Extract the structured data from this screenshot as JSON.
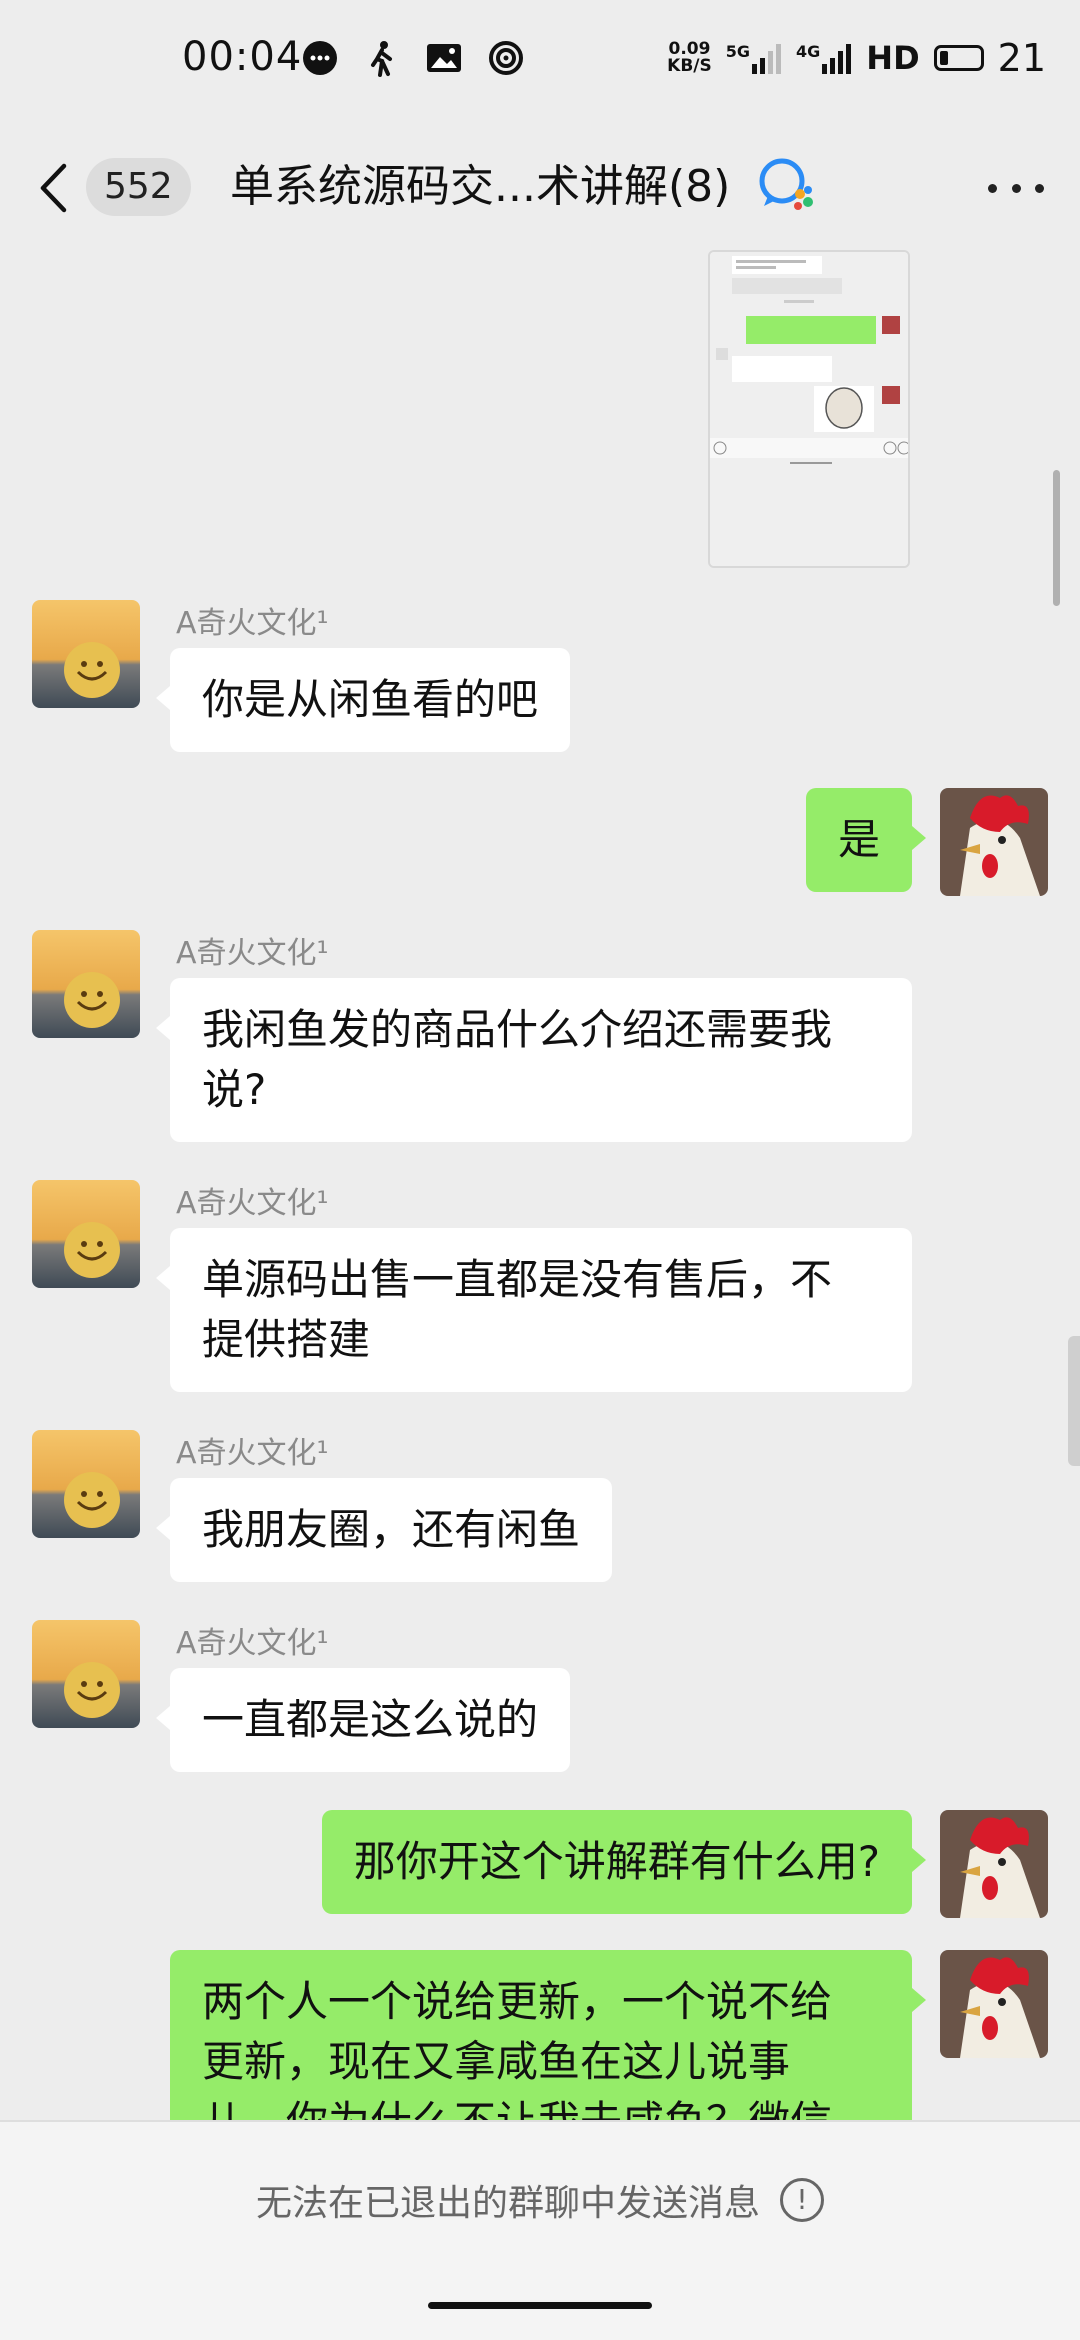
{
  "status_bar": {
    "time": "00:04",
    "net_speed_top": "0.09",
    "net_speed_bottom": "KB/S",
    "signal_1": "5G",
    "signal_2": "4G",
    "hd": "HD",
    "battery": "21"
  },
  "nav": {
    "back_icon": "chevron-left-icon",
    "unread_count": "552",
    "title": "单系统源码交...术讲解(8)",
    "more_icon": "more-dots-icon"
  },
  "messages": [
    {
      "side": "left",
      "sender": "A奇火文化¹",
      "text": "你是从闲鱼看的吧"
    },
    {
      "side": "right",
      "text": "是"
    },
    {
      "side": "left",
      "sender": "A奇火文化¹",
      "line1": "我闲鱼发的商品什么介绍还需要我",
      "line2": "说?"
    },
    {
      "side": "left",
      "sender": "A奇火文化¹",
      "line1": "单源码出售一直都是没有售后，不",
      "line2": "提供搭建"
    },
    {
      "side": "left",
      "sender": "A奇火文化¹",
      "text": "我朋友圈，还有闲鱼"
    },
    {
      "side": "left",
      "sender": "A奇火文化¹",
      "text": "一直都是这么说的"
    },
    {
      "side": "right",
      "text": "那你开这个讲解群有什么用?"
    },
    {
      "side": "right",
      "line1": "两个人一个说给更新，一个说不给",
      "line2": "更新，现在又拿咸鱼在这儿说事",
      "line3": "儿，你为什么不让我去咸鱼？微信"
    }
  ],
  "bottom": {
    "notice": "无法在已退出的群聊中发送消息",
    "info_icon": "!"
  },
  "colors": {
    "bg": "#ededed",
    "green_bubble": "#95ec69",
    "white_bubble": "#ffffff"
  }
}
